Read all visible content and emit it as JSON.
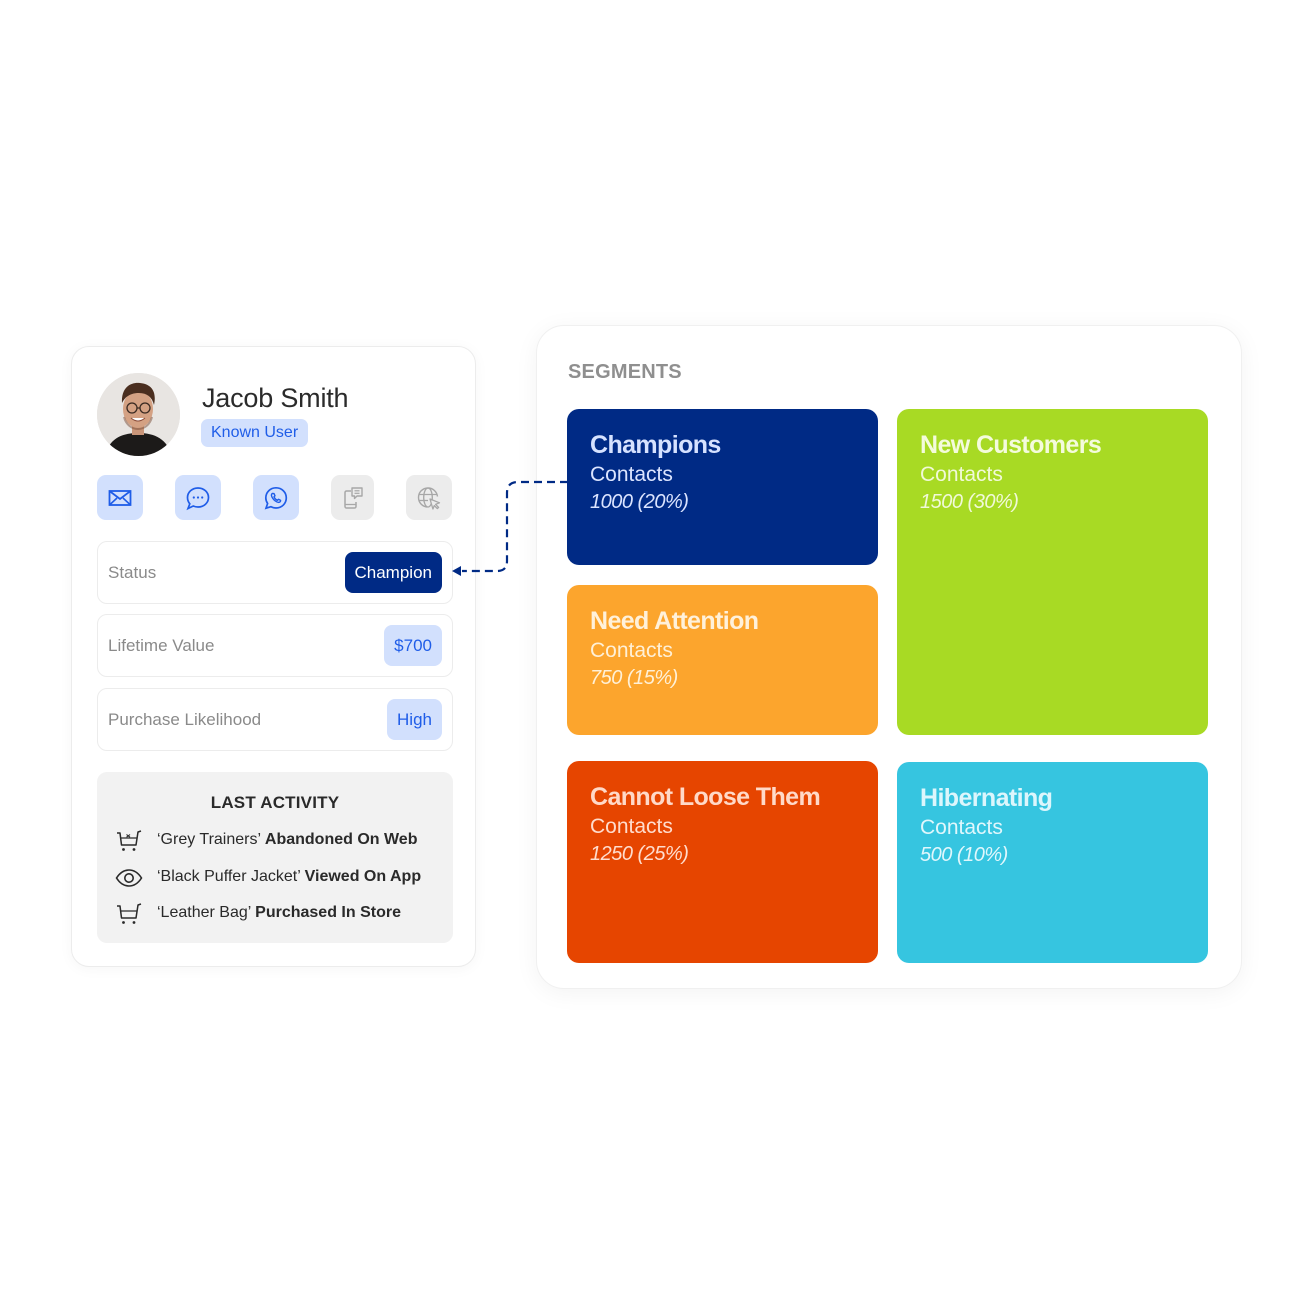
{
  "profile": {
    "name": "Jacob Smith",
    "badge": "Known User",
    "avatar": "profile-photo",
    "channels": [
      {
        "icon": "email-icon",
        "active": true
      },
      {
        "icon": "chat-icon",
        "active": true
      },
      {
        "icon": "whatsapp-icon",
        "active": true
      },
      {
        "icon": "mobile-message-icon",
        "active": false
      },
      {
        "icon": "web-cursor-icon",
        "active": false
      }
    ],
    "fields": [
      {
        "label": "Status",
        "value": "Champion",
        "style": "primary"
      },
      {
        "label": "Lifetime Value",
        "value": "$700",
        "style": "soft"
      },
      {
        "label": "Purchase Likelihood",
        "value": "High",
        "style": "soft"
      }
    ],
    "activity": {
      "title": "LAST ACTIVITY",
      "items": [
        {
          "icon": "cart-abandoned-icon",
          "item": "‘Grey Trainers’",
          "action": "Abandoned On Web"
        },
        {
          "icon": "eye-icon",
          "item": "‘Black Puffer Jacket’",
          "action": "Viewed On App"
        },
        {
          "icon": "cart-icon",
          "item": "‘Leather Bag’",
          "action": "Purchased In Store"
        }
      ]
    }
  },
  "segments": {
    "title": "SEGMENTS",
    "items": [
      {
        "name": "Champions",
        "sub": "Contacts",
        "count": "1000 (20%)",
        "bg": "#002a85",
        "name_color": "#d6e2ff",
        "text_color": "#dbe4ff"
      },
      {
        "name": "New Customers",
        "sub": "Contacts",
        "count": "1500 (30%)",
        "bg": "#a8da24",
        "name_color": "#f4fbdc",
        "text_color": "#f1f9d8"
      },
      {
        "name": "Need Attention",
        "sub": "Contacts",
        "count": "750 (15%)",
        "bg": "#fca52d",
        "name_color": "#fff1da",
        "text_color": "#fff0d6"
      },
      {
        "name": "Cannot Loose Them",
        "sub": "Contacts",
        "count": "1250 (25%)",
        "bg": "#e64500",
        "name_color": "#ffd9c8",
        "text_color": "#ffdccd"
      },
      {
        "name": "Hibernating",
        "sub": "Contacts",
        "count": "500 (10%)",
        "bg": "#36c5e0",
        "name_color": "#dcf6fc",
        "text_color": "#e0f7fc"
      }
    ]
  },
  "colors": {
    "accent": "#1f5de8",
    "accent_soft": "#d2e0fd",
    "champion_navy": "#002a85",
    "connector": "#002a85"
  }
}
